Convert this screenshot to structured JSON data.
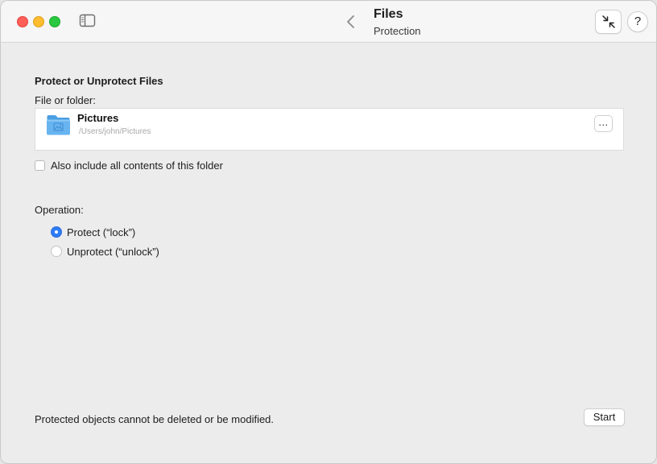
{
  "window": {
    "title": "Files",
    "subtitle": "Protection",
    "help_label": "?"
  },
  "icons": {
    "sidebar_toggle": "sidebar-toggle-icon",
    "back": "chevron-left-icon",
    "collapse": "collapse-arrows-icon",
    "folder": "pictures-folder-icon"
  },
  "colors": {
    "close": "#ff5f57",
    "minimize": "#febc2e",
    "maximize": "#28c840",
    "accent": "#2f7cf6",
    "folder": "#68b4f0"
  },
  "form": {
    "section_title": "Protect or Unprotect Files",
    "file_label": "File or folder:",
    "file": {
      "name": "Pictures",
      "path": "/Users/john/Pictures",
      "browse_label": "..."
    },
    "include_contents": {
      "label": "Also include all contents of this folder",
      "checked": false
    },
    "operation": {
      "label": "Operation:",
      "options": [
        {
          "label": "Protect (“lock”)",
          "selected": true
        },
        {
          "label": "Unprotect (“unlock”)",
          "selected": false
        }
      ]
    }
  },
  "footer": {
    "note": "Protected objects cannot be deleted or be modified.",
    "start_label": "Start"
  }
}
